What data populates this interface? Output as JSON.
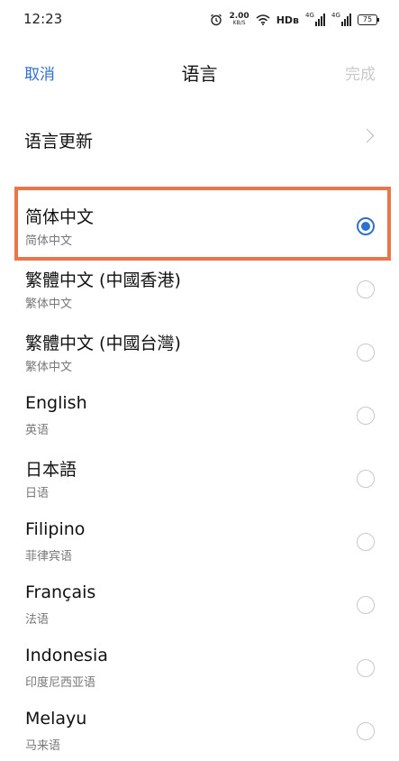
{
  "status_bar": {
    "time": "12:23",
    "speed_value": "2.00",
    "speed_unit": "KB/S",
    "hd_label": "HDʙ",
    "network_1": "4G",
    "network_2": "4G",
    "battery": "75"
  },
  "nav": {
    "cancel_label": "取消",
    "title": "语言",
    "done_label": "完成"
  },
  "update_row": {
    "label": "语言更新"
  },
  "languages": [
    {
      "name": "简体中文",
      "sub": "简体中文",
      "selected": true
    },
    {
      "name": "繁體中文 (中國香港)",
      "sub": "繁体中文",
      "selected": false
    },
    {
      "name": "繁體中文 (中國台灣)",
      "sub": "繁体中文",
      "selected": false
    },
    {
      "name": "English",
      "sub": "英语",
      "selected": false
    },
    {
      "name": "日本語",
      "sub": "日语",
      "selected": false
    },
    {
      "name": "Filipino",
      "sub": "菲律宾语",
      "selected": false
    },
    {
      "name": "Français",
      "sub": "法语",
      "selected": false
    },
    {
      "name": "Indonesia",
      "sub": "印度尼西亚语",
      "selected": false
    },
    {
      "name": "Melayu",
      "sub": "马来语",
      "selected": false
    }
  ],
  "colors": {
    "accent": "#2f6fd0",
    "highlight": "#e8764a",
    "disabled": "#c9c9c9"
  }
}
